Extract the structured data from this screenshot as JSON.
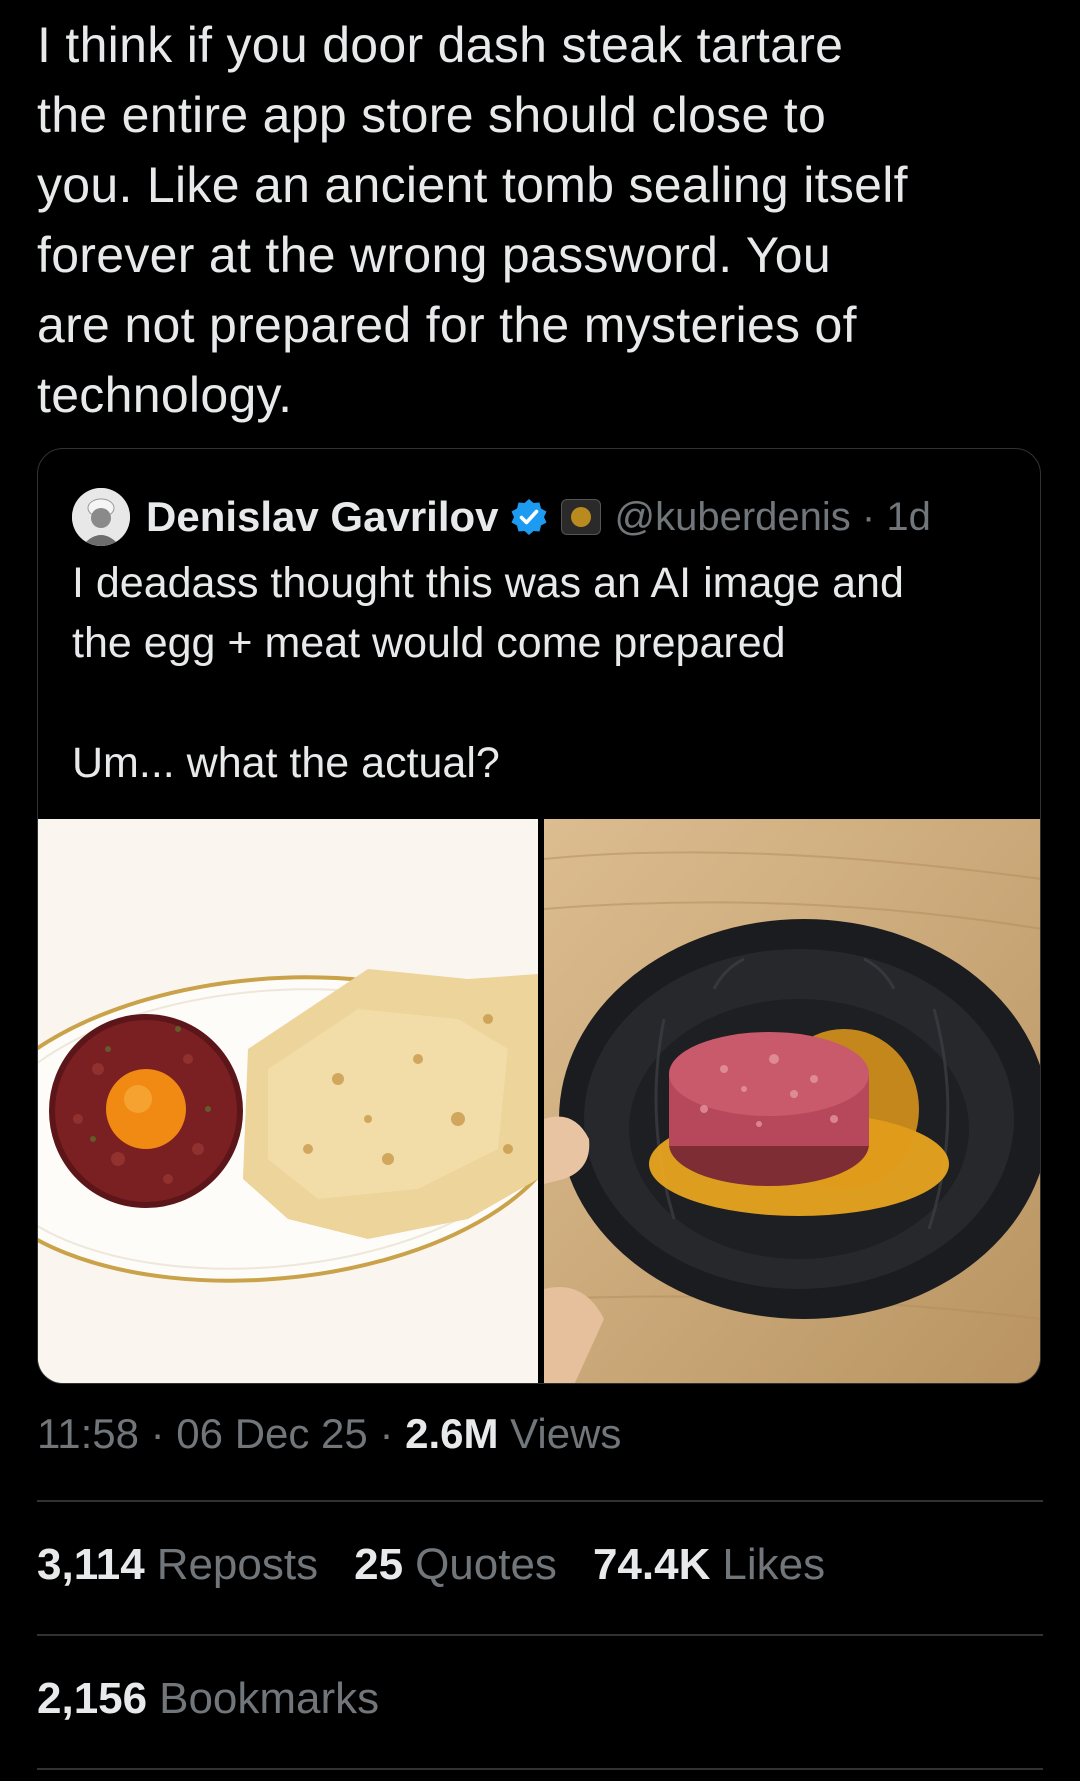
{
  "tweet": {
    "text": "I think if you door dash steak tartare\nthe entire app store should close to\nyou. Like an ancient tomb sealing itself\nforever at the wrong password. You\nare not prepared for the mysteries of\ntechnology."
  },
  "quote": {
    "name": "Denislav Gavrilov",
    "handle": "@kuberdenis · 1d",
    "text": "I deadass thought this was an AI image and\nthe egg + meat would come prepared\n\nUm... what the actual?"
  },
  "meta": {
    "time_date": "11:58 · 06 Dec 25 · ",
    "views_count": "2.6M",
    "views_label": " Views"
  },
  "stats": {
    "reposts_count": "3,114",
    "reposts_label": "Reposts",
    "quotes_count": "25",
    "quotes_label": "Quotes",
    "likes_count": "74.4K",
    "likes_label": "Likes",
    "bookmarks_count": "2,156",
    "bookmarks_label": "Bookmarks"
  },
  "colors": {
    "background": "#000000",
    "text_primary": "#e7e9ea",
    "text_secondary": "#71767b",
    "verified": "#1d9bf0",
    "border": "#2f3336"
  }
}
